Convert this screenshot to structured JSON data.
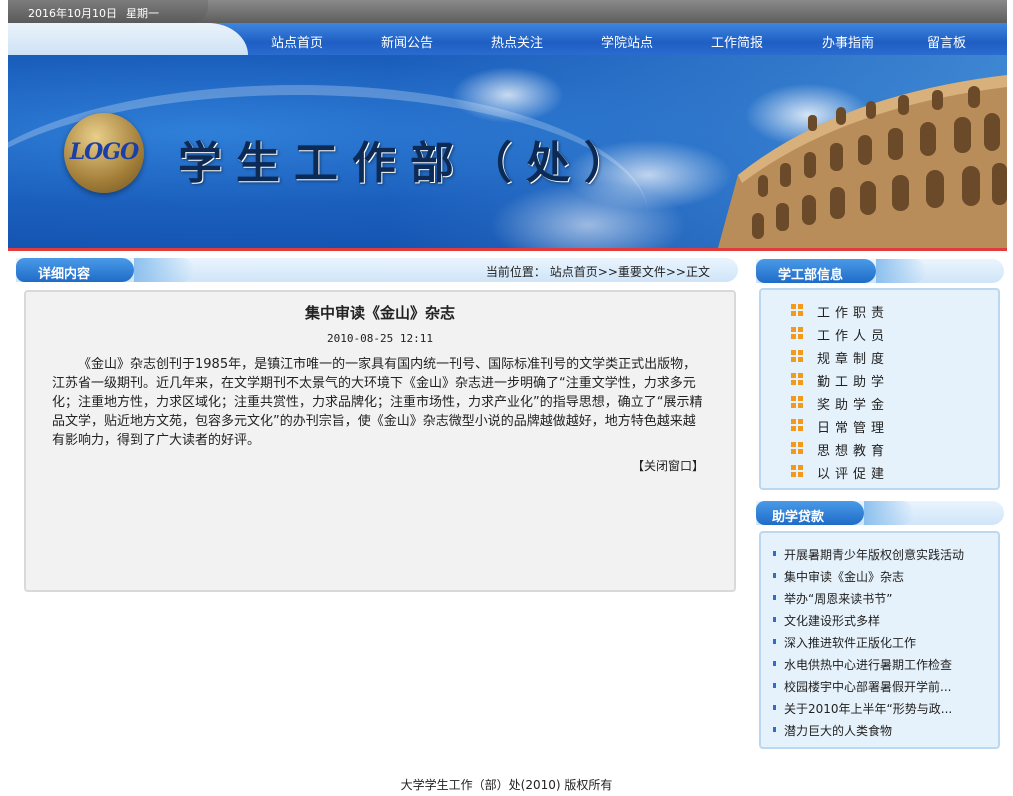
{
  "topbar": {
    "date": "2016年10月10日",
    "weekday": "星期一"
  },
  "nav": {
    "items": [
      "站点首页",
      "新闻公告",
      "热点关注",
      "学院站点",
      "工作简报",
      "办事指南",
      "留言板"
    ]
  },
  "banner": {
    "logo_text": "LOGO",
    "title": "学生工作部（处）"
  },
  "content": {
    "section_title": "详细内容",
    "breadcrumb_label": "当前位置：",
    "breadcrumb_path": "站点首页>>重要文件>>正文",
    "article": {
      "title": "集中审读《金山》杂志",
      "time": "2010-08-25 12:11",
      "body": "《金山》杂志创刊于1985年，是镇江市唯一的一家具有国内统一刊号、国际标准刊号的文学类正式出版物，江苏省一级期刊。近几年来，在文学期刊不太景气的大环境下《金山》杂志进一步明确了“注重文学性，力求多元化；注重地方性，力求区域化；注重共赏性，力求品牌化；注重市场性，力求产业化”的指导思想，确立了“展示精品文学，贴近地方文苑，包容多元文化”的办刊宗旨，使《金山》杂志微型小说的品牌越做越好，地方特色越来越有影响力，得到了广大读者的好评。",
      "close_label": "【关闭窗口】"
    }
  },
  "sidebar": {
    "info": {
      "title": "学工部信息",
      "items": [
        "工作职责",
        "工作人员",
        "规章制度",
        "勤工助学",
        "奖助学金",
        "日常管理",
        "思想教育",
        "以评促建"
      ]
    },
    "loans": {
      "title": "助学贷款",
      "items": [
        "开展暑期青少年版权创意实践活动",
        "集中审读《金山》杂志",
        "举办“周恩来读书节”",
        "文化建设形式多样",
        "深入推进软件正版化工作",
        "水电供热中心进行暑期工作检查",
        "校园楼宇中心部署暑假开学前...",
        "关于2010年上半年“形势与政...",
        "潜力巨大的人类食物"
      ]
    }
  },
  "footer": {
    "copyright": "大学学生工作（部）处(2010) 版权所有"
  },
  "colors": {
    "nav_blue": "#2a6bd0",
    "accent_red": "#e23b3b",
    "bullet_orange": "#f39a1b",
    "panel_blue": "#e6f2fb"
  }
}
